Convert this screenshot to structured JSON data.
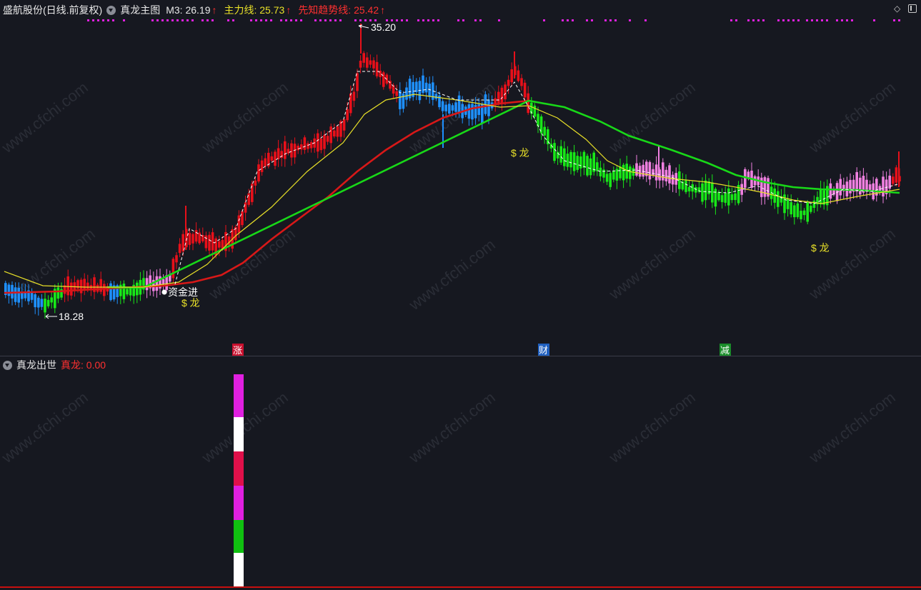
{
  "header": {
    "stock_title": "盛航股份(日线.前复权)",
    "indicator_name": "真龙主图",
    "m3_label": "M3: 26.19",
    "m3_arrow": "↑",
    "main_line_label": "主力线: 25.73",
    "main_line_arrow": "↑",
    "trend_line_label": "先知趋势线: 25.42",
    "trend_line_arrow": "↑"
  },
  "annotations": {
    "high_price": "35.20",
    "low_price": "18.28",
    "fund_in": "资金进",
    "dragon_1": "$ 龙",
    "dragon_2": "$ 龙",
    "dragon_3": "$ 龙"
  },
  "axis_tags": [
    {
      "label": "涨",
      "color": "#c8102e"
    },
    {
      "label": "财",
      "color": "#2060c0"
    },
    {
      "label": "减",
      "color": "#1a8c2a"
    }
  ],
  "sub_panel": {
    "indicator_name": "真龙出世",
    "value_label": "真龙: 0.00"
  },
  "watermark": "www.cfchi.com",
  "colors": {
    "background": "#161820",
    "candle_red": "#e8101a",
    "candle_blue": "#1e90ff",
    "candle_green": "#18e818",
    "candle_pink": "#f080e0",
    "ma_yellow": "#e8e028",
    "ma_red": "#d81818",
    "ma_green": "#18d818",
    "dots_magenta": "#e020e0",
    "header_yellow": "#e8e028",
    "header_red": "#ff3030"
  },
  "chart_data": {
    "type": "candlestick",
    "title": "盛航股份(日线.前复权)",
    "price_high": 35.2,
    "price_low": 18.28,
    "series": [
      {
        "name": "M3",
        "last_value": 26.19
      },
      {
        "name": "主力线",
        "last_value": 25.73
      },
      {
        "name": "先知趋势线",
        "last_value": 25.42
      }
    ],
    "sub_chart": {
      "name": "真龙",
      "last_value": 0.0
    }
  }
}
